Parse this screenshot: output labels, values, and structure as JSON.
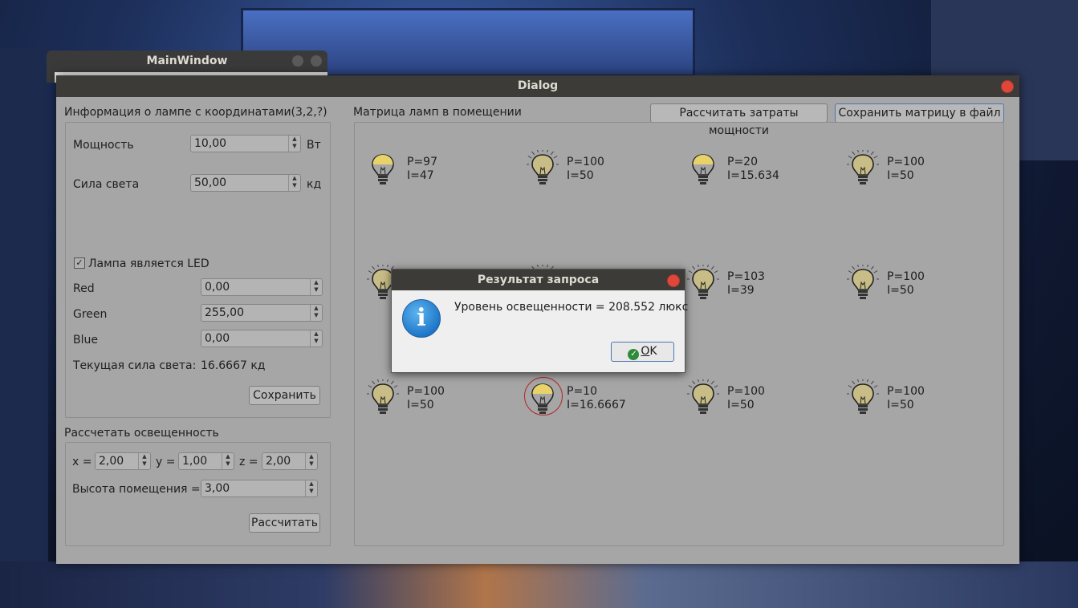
{
  "main_window": {
    "title": "MainWindow"
  },
  "dialog": {
    "title": "Dialog",
    "lamp_info": {
      "header": "Информация о лампе с координатами(3,2,?)",
      "power_label": "Мощность",
      "power_value": "10,00",
      "power_unit": "Вт",
      "intensity_label": "Сила света",
      "intensity_value": "50,00",
      "intensity_unit": "кд",
      "led_checkbox_label": "Лампа является LED",
      "led_checked": true,
      "red_label": "Red",
      "red_value": "0,00",
      "green_label": "Green",
      "green_value": "255,00",
      "blue_label": "Blue",
      "blue_value": "0,00",
      "current_intensity_label": "Текущая сила света:",
      "current_intensity_value": "16.6667 кд",
      "save_button": "Сохранить"
    },
    "illumination": {
      "header": "Рассчетать освещенность",
      "x_label": "x =",
      "x_value": "2,00",
      "y_label": "y =",
      "y_value": "1,00",
      "z_label": "z =",
      "z_value": "2,00",
      "height_label": "Высота помещения =",
      "height_value": "3,00",
      "calc_button": "Рассчитать"
    },
    "matrix": {
      "header": "Матрица ламп в помещении",
      "calc_power_button": "Рассчитать затраты мощности",
      "save_matrix_button": "Сохранить матрицу в файл",
      "lamps": [
        {
          "p": "P=97",
          "i": "I=47",
          "lit": false,
          "selected": false
        },
        {
          "p": "P=100",
          "i": "I=50",
          "lit": true,
          "selected": false
        },
        {
          "p": "P=20",
          "i": "I=15.634",
          "lit": false,
          "selected": false
        },
        {
          "p": "P=100",
          "i": "I=50",
          "lit": true,
          "selected": false
        },
        {
          "p": "",
          "i": "",
          "lit": true,
          "selected": false
        },
        {
          "p": "",
          "i": "",
          "lit": true,
          "selected": false
        },
        {
          "p": "P=103",
          "i": "I=39",
          "lit": true,
          "selected": false
        },
        {
          "p": "P=100",
          "i": "I=50",
          "lit": true,
          "selected": false
        },
        {
          "p": "P=100",
          "i": "I=50",
          "lit": true,
          "selected": false
        },
        {
          "p": "P=10",
          "i": "I=16.6667",
          "lit": false,
          "selected": true
        },
        {
          "p": "P=100",
          "i": "I=50",
          "lit": true,
          "selected": false
        },
        {
          "p": "P=100",
          "i": "I=50",
          "lit": true,
          "selected": false
        }
      ]
    }
  },
  "message_box": {
    "title": "Результат запроса",
    "text": "Уровень освещенности = 208.552 люкс",
    "ok_button_mnemonic": "O",
    "ok_button_rest": "K"
  },
  "colors": {
    "dialog_bg": "#a6a6a6",
    "titlebar": "#3c3b37",
    "close_red": "#e0473a",
    "bulb_yellow": "#e8d36a",
    "selected_ring": "#b0252a"
  }
}
